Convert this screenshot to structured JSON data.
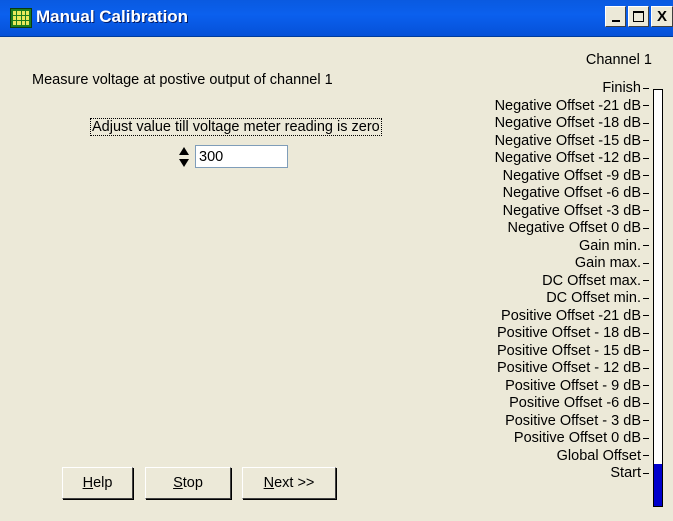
{
  "window": {
    "title": "Manual Calibration",
    "buttons": {
      "minimize": "_",
      "maximize": "□",
      "close": "X"
    }
  },
  "main": {
    "instruction": "Measure voltage at postive output of channel 1",
    "adjust_label": "Adjust value till voltage meter reading is zero",
    "value": "300"
  },
  "steps": {
    "channel_label": "Channel 1",
    "items": [
      "Finish",
      "Negative Offset -21 dB",
      "Negative Offset -18 dB",
      "Negative Offset -15 dB",
      "Negative Offset -12 dB",
      "Negative Offset -9 dB",
      "Negative Offset -6 dB",
      "Negative Offset -3 dB",
      "Negative Offset 0 dB",
      "Gain min.",
      "Gain max.",
      "DC Offset max.",
      "DC Offset min.",
      "Positive Offset -21 dB",
      "Positive Offset - 18 dB",
      "Positive Offset - 15 dB",
      "Positive Offset - 12 dB",
      "Positive Offset - 9 dB",
      "Positive Offset -6 dB",
      "Positive Offset - 3 dB",
      "Positive Offset 0 dB",
      "Global Offset",
      "Start"
    ],
    "progress_fraction": 0.1
  },
  "buttons": {
    "help": {
      "mnemonic": "H",
      "rest": "elp"
    },
    "stop": {
      "mnemonic": "S",
      "rest": "top"
    },
    "next": {
      "mnemonic": "N",
      "rest": "ext >>"
    }
  },
  "colors": {
    "titlebar": "#0b60ee",
    "progress": "#0000cc"
  }
}
